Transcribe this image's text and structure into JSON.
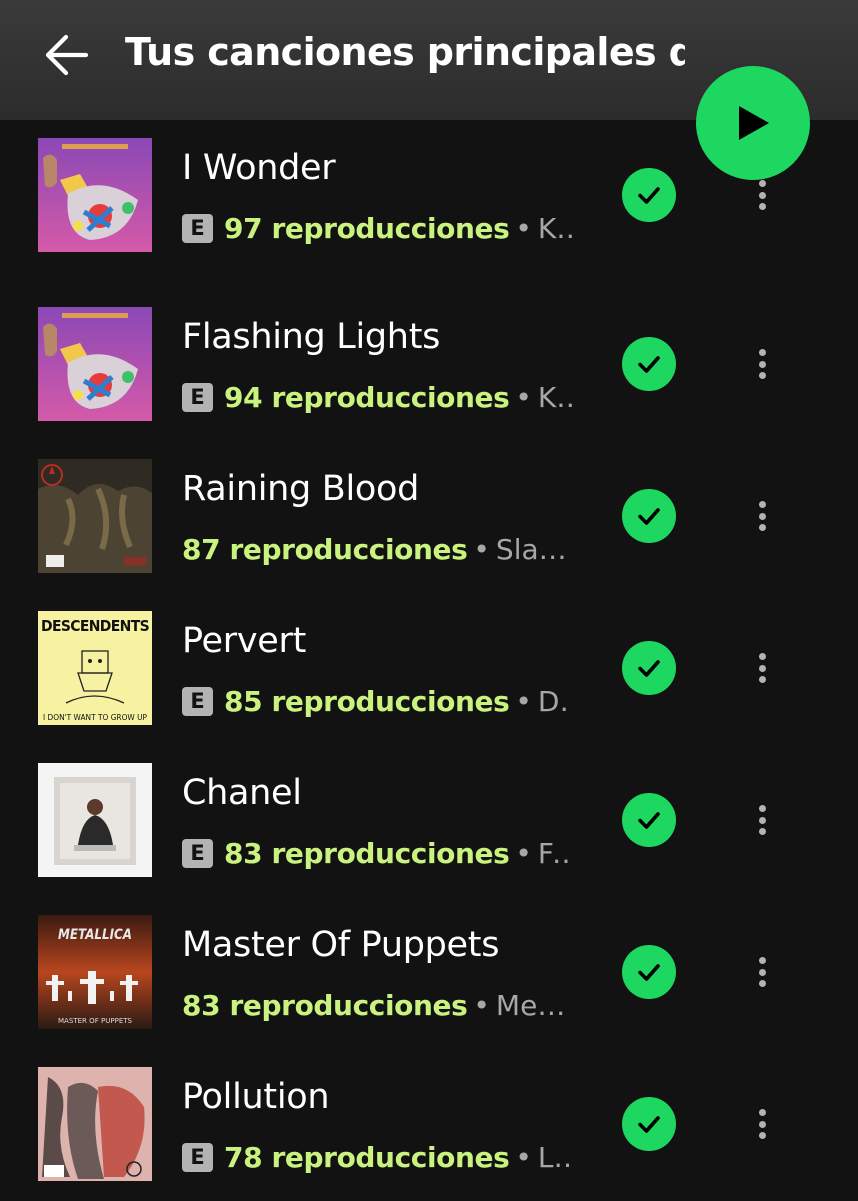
{
  "header": {
    "title": "Tus canciones principales de",
    "back_icon": "arrow-left-icon",
    "play_icon": "play-icon",
    "accent_color": "#1ed760"
  },
  "tracks": [
    {
      "title": "I Wonder",
      "explicit": true,
      "explicit_label": "E",
      "plays": "97 reproducciones",
      "separator": "•",
      "artist": "K…",
      "art": "graduation"
    },
    {
      "title": "Flashing Lights",
      "explicit": true,
      "explicit_label": "E",
      "plays": "94 reproducciones",
      "separator": "•",
      "artist": "K…",
      "art": "graduation"
    },
    {
      "title": "Raining Blood",
      "explicit": false,
      "explicit_label": "",
      "plays": "87 reproducciones",
      "separator": "•",
      "artist": "Slayer",
      "art": "reign"
    },
    {
      "title": "Pervert",
      "explicit": true,
      "explicit_label": "E",
      "plays": "85 reproducciones",
      "separator": "•",
      "artist": "D…",
      "art": "descendents",
      "art_text_top": "DESCENDENTS",
      "art_text_bottom": "I DON'T WANT TO GROW UP"
    },
    {
      "title": "Chanel",
      "explicit": true,
      "explicit_label": "E",
      "plays": "83 reproducciones",
      "separator": "•",
      "artist": "Fr…",
      "art": "photo"
    },
    {
      "title": "Master Of Puppets",
      "explicit": false,
      "explicit_label": "",
      "plays": "83 reproducciones",
      "separator": "•",
      "artist": "Meta…",
      "art": "metallica",
      "art_text_top": "METALLICA",
      "art_text_bottom": "MASTER OF PUPPETS"
    },
    {
      "title": "Pollution",
      "explicit": true,
      "explicit_label": "E",
      "plays": "78 reproducciones",
      "separator": "•",
      "artist": "Li…",
      "art": "limp"
    }
  ],
  "icons": {
    "saved": "checkmark-icon",
    "more": "more-vertical-icon"
  },
  "colors": {
    "background": "#121212",
    "plays_text": "#c9f27e",
    "secondary_text": "#a7a7a7"
  }
}
